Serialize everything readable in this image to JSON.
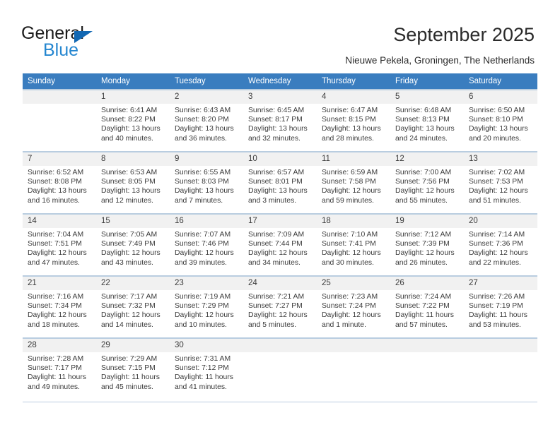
{
  "brand": {
    "name_top": "General",
    "name_bottom": "Blue",
    "accent_color": "#2486d0",
    "triangle_color": "#1268b3"
  },
  "header": {
    "title": "September 2025",
    "subtitle": "Nieuwe Pekela, Groningen, The Netherlands"
  },
  "calendar": {
    "header_bg": "#3a7dbf",
    "weekday_headers": [
      "Sunday",
      "Monday",
      "Tuesday",
      "Wednesday",
      "Thursday",
      "Friday",
      "Saturday"
    ],
    "weeks": [
      [
        {
          "day": "",
          "sunrise": "",
          "sunset": "",
          "daylight": ""
        },
        {
          "day": "1",
          "sunrise": "Sunrise: 6:41 AM",
          "sunset": "Sunset: 8:22 PM",
          "daylight": "Daylight: 13 hours and 40 minutes."
        },
        {
          "day": "2",
          "sunrise": "Sunrise: 6:43 AM",
          "sunset": "Sunset: 8:20 PM",
          "daylight": "Daylight: 13 hours and 36 minutes."
        },
        {
          "day": "3",
          "sunrise": "Sunrise: 6:45 AM",
          "sunset": "Sunset: 8:17 PM",
          "daylight": "Daylight: 13 hours and 32 minutes."
        },
        {
          "day": "4",
          "sunrise": "Sunrise: 6:47 AM",
          "sunset": "Sunset: 8:15 PM",
          "daylight": "Daylight: 13 hours and 28 minutes."
        },
        {
          "day": "5",
          "sunrise": "Sunrise: 6:48 AM",
          "sunset": "Sunset: 8:13 PM",
          "daylight": "Daylight: 13 hours and 24 minutes."
        },
        {
          "day": "6",
          "sunrise": "Sunrise: 6:50 AM",
          "sunset": "Sunset: 8:10 PM",
          "daylight": "Daylight: 13 hours and 20 minutes."
        }
      ],
      [
        {
          "day": "7",
          "sunrise": "Sunrise: 6:52 AM",
          "sunset": "Sunset: 8:08 PM",
          "daylight": "Daylight: 13 hours and 16 minutes."
        },
        {
          "day": "8",
          "sunrise": "Sunrise: 6:53 AM",
          "sunset": "Sunset: 8:05 PM",
          "daylight": "Daylight: 13 hours and 12 minutes."
        },
        {
          "day": "9",
          "sunrise": "Sunrise: 6:55 AM",
          "sunset": "Sunset: 8:03 PM",
          "daylight": "Daylight: 13 hours and 7 minutes."
        },
        {
          "day": "10",
          "sunrise": "Sunrise: 6:57 AM",
          "sunset": "Sunset: 8:01 PM",
          "daylight": "Daylight: 13 hours and 3 minutes."
        },
        {
          "day": "11",
          "sunrise": "Sunrise: 6:59 AM",
          "sunset": "Sunset: 7:58 PM",
          "daylight": "Daylight: 12 hours and 59 minutes."
        },
        {
          "day": "12",
          "sunrise": "Sunrise: 7:00 AM",
          "sunset": "Sunset: 7:56 PM",
          "daylight": "Daylight: 12 hours and 55 minutes."
        },
        {
          "day": "13",
          "sunrise": "Sunrise: 7:02 AM",
          "sunset": "Sunset: 7:53 PM",
          "daylight": "Daylight: 12 hours and 51 minutes."
        }
      ],
      [
        {
          "day": "14",
          "sunrise": "Sunrise: 7:04 AM",
          "sunset": "Sunset: 7:51 PM",
          "daylight": "Daylight: 12 hours and 47 minutes."
        },
        {
          "day": "15",
          "sunrise": "Sunrise: 7:05 AM",
          "sunset": "Sunset: 7:49 PM",
          "daylight": "Daylight: 12 hours and 43 minutes."
        },
        {
          "day": "16",
          "sunrise": "Sunrise: 7:07 AM",
          "sunset": "Sunset: 7:46 PM",
          "daylight": "Daylight: 12 hours and 39 minutes."
        },
        {
          "day": "17",
          "sunrise": "Sunrise: 7:09 AM",
          "sunset": "Sunset: 7:44 PM",
          "daylight": "Daylight: 12 hours and 34 minutes."
        },
        {
          "day": "18",
          "sunrise": "Sunrise: 7:10 AM",
          "sunset": "Sunset: 7:41 PM",
          "daylight": "Daylight: 12 hours and 30 minutes."
        },
        {
          "day": "19",
          "sunrise": "Sunrise: 7:12 AM",
          "sunset": "Sunset: 7:39 PM",
          "daylight": "Daylight: 12 hours and 26 minutes."
        },
        {
          "day": "20",
          "sunrise": "Sunrise: 7:14 AM",
          "sunset": "Sunset: 7:36 PM",
          "daylight": "Daylight: 12 hours and 22 minutes."
        }
      ],
      [
        {
          "day": "21",
          "sunrise": "Sunrise: 7:16 AM",
          "sunset": "Sunset: 7:34 PM",
          "daylight": "Daylight: 12 hours and 18 minutes."
        },
        {
          "day": "22",
          "sunrise": "Sunrise: 7:17 AM",
          "sunset": "Sunset: 7:32 PM",
          "daylight": "Daylight: 12 hours and 14 minutes."
        },
        {
          "day": "23",
          "sunrise": "Sunrise: 7:19 AM",
          "sunset": "Sunset: 7:29 PM",
          "daylight": "Daylight: 12 hours and 10 minutes."
        },
        {
          "day": "24",
          "sunrise": "Sunrise: 7:21 AM",
          "sunset": "Sunset: 7:27 PM",
          "daylight": "Daylight: 12 hours and 5 minutes."
        },
        {
          "day": "25",
          "sunrise": "Sunrise: 7:23 AM",
          "sunset": "Sunset: 7:24 PM",
          "daylight": "Daylight: 12 hours and 1 minute."
        },
        {
          "day": "26",
          "sunrise": "Sunrise: 7:24 AM",
          "sunset": "Sunset: 7:22 PM",
          "daylight": "Daylight: 11 hours and 57 minutes."
        },
        {
          "day": "27",
          "sunrise": "Sunrise: 7:26 AM",
          "sunset": "Sunset: 7:19 PM",
          "daylight": "Daylight: 11 hours and 53 minutes."
        }
      ],
      [
        {
          "day": "28",
          "sunrise": "Sunrise: 7:28 AM",
          "sunset": "Sunset: 7:17 PM",
          "daylight": "Daylight: 11 hours and 49 minutes."
        },
        {
          "day": "29",
          "sunrise": "Sunrise: 7:29 AM",
          "sunset": "Sunset: 7:15 PM",
          "daylight": "Daylight: 11 hours and 45 minutes."
        },
        {
          "day": "30",
          "sunrise": "Sunrise: 7:31 AM",
          "sunset": "Sunset: 7:12 PM",
          "daylight": "Daylight: 11 hours and 41 minutes."
        },
        {
          "day": "",
          "sunrise": "",
          "sunset": "",
          "daylight": ""
        },
        {
          "day": "",
          "sunrise": "",
          "sunset": "",
          "daylight": ""
        },
        {
          "day": "",
          "sunrise": "",
          "sunset": "",
          "daylight": ""
        },
        {
          "day": "",
          "sunrise": "",
          "sunset": "",
          "daylight": ""
        }
      ]
    ]
  }
}
